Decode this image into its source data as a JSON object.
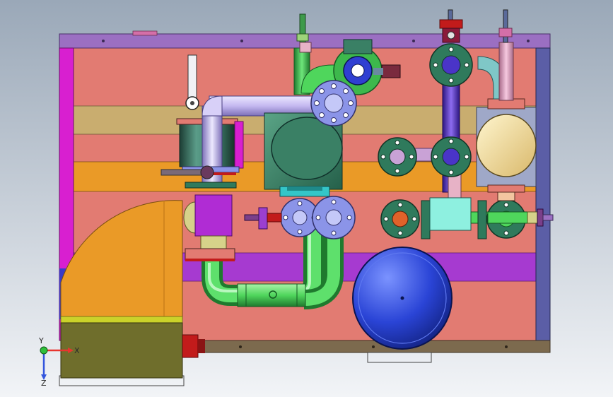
{
  "window": {
    "title": ""
  },
  "viewport": {
    "background_top": "#9aa8b8",
    "background_bottom": "#f2f4f7"
  },
  "colors": {
    "frame_purple": "#9b6fc2",
    "panel_salmon": "#e27b72",
    "band_tan": "#c9ad6f",
    "band_orange": "#ea9a27",
    "band_magenta": "#a63ad0",
    "left_post_magenta": "#d81fd0",
    "right_post_blue": "#5b5ea6",
    "base_rail_brown": "#7c6a4e",
    "tank_blue": "#2a44d6",
    "pipe_green": "#4fd65c",
    "pipe_lavender": "#c4b8f0",
    "pipe_purple": "#6a3bcf",
    "flange_blue": "#8b94e8",
    "flange_green": "#2f7a5c",
    "body_teal": "#3a8065",
    "body_cyan": "#34c6c8",
    "pump_cream": "#f7e0a0",
    "block_olive": "#6f6e2c",
    "block_yellow": "#cbd22a",
    "red_part": "#c21b1b"
  },
  "triad": {
    "x_label": "X",
    "y_label": "Y",
    "z_label": "Z",
    "x_color": "#e8352f",
    "y_color": "#2fbf3b",
    "z_color": "#3355dd"
  }
}
